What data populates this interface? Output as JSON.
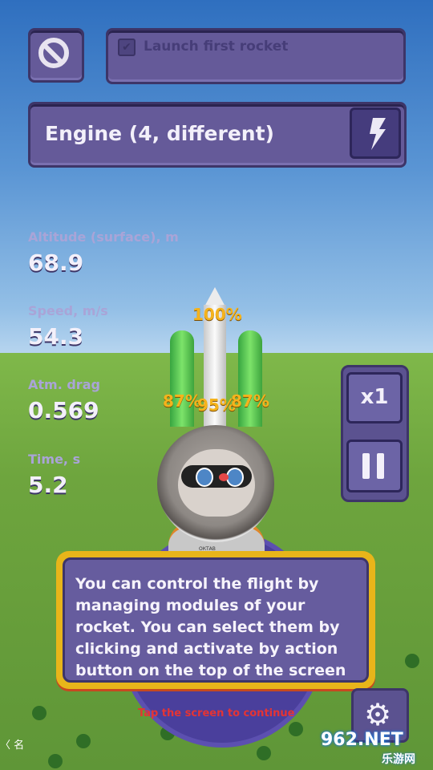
{
  "top_bar": {
    "mission_label": "Launch first rocket",
    "mission_checked": true
  },
  "engine": {
    "label": "Engine (4, different)"
  },
  "stats": [
    {
      "label": "Altitude (surface), m",
      "value": "68.9"
    },
    {
      "label": "Speed, m/s",
      "value": "54.3"
    },
    {
      "label": "Atm. drag",
      "value": "0.569"
    },
    {
      "label": "Time, s",
      "value": "5.2"
    }
  ],
  "controls": {
    "speed_label": "x1"
  },
  "rocket": {
    "top_percent": "100%",
    "left_booster_percent": "87%",
    "center_percent": "95%",
    "right_booster_percent": "87%"
  },
  "character": {
    "suit_tag": "ОКТАВ"
  },
  "tutorial": {
    "text": "You can control the flight by managing modules of your rocket. You can select them by clicking and activate by action button on the top of the screen",
    "continue_hint": "Tap the screen to continue"
  },
  "watermark": {
    "top": "962.NET",
    "bottom": "乐游网"
  },
  "nav": {
    "back_label": "〈 名"
  }
}
